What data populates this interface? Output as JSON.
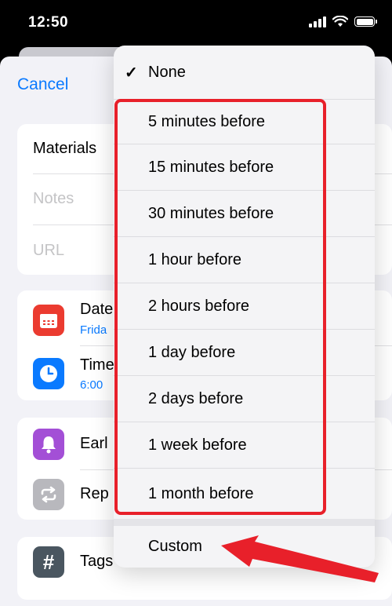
{
  "status": {
    "time": "12:50"
  },
  "sheet": {
    "cancel_label": "Cancel",
    "title_value": "Materials",
    "notes_placeholder": "Notes",
    "url_placeholder": "URL",
    "date": {
      "label": "Date",
      "value": "Frida",
      "icon": "calendar-icon",
      "color": "#eb3b30"
    },
    "time": {
      "label": "Time",
      "value": "6:00",
      "icon": "clock-icon",
      "color": "#0a7aff"
    },
    "early": {
      "label": "Earl",
      "icon": "bell-icon",
      "color": "#a34fd6"
    },
    "repeat": {
      "label": "Rep",
      "icon": "repeat-icon",
      "color": "#b8b8bd"
    },
    "tags": {
      "label": "Tags",
      "icon": "hashtag-icon",
      "color": "#4a5660"
    }
  },
  "menu": {
    "none_label": "None",
    "items": [
      "5 minutes before",
      "15 minutes before",
      "30 minutes before",
      "1 hour before",
      "2 hours before",
      "1 day before",
      "2 days before",
      "1 week before",
      "1 month before"
    ],
    "custom_label": "Custom"
  },
  "annotation": {
    "highlight_color": "#e8202a"
  }
}
